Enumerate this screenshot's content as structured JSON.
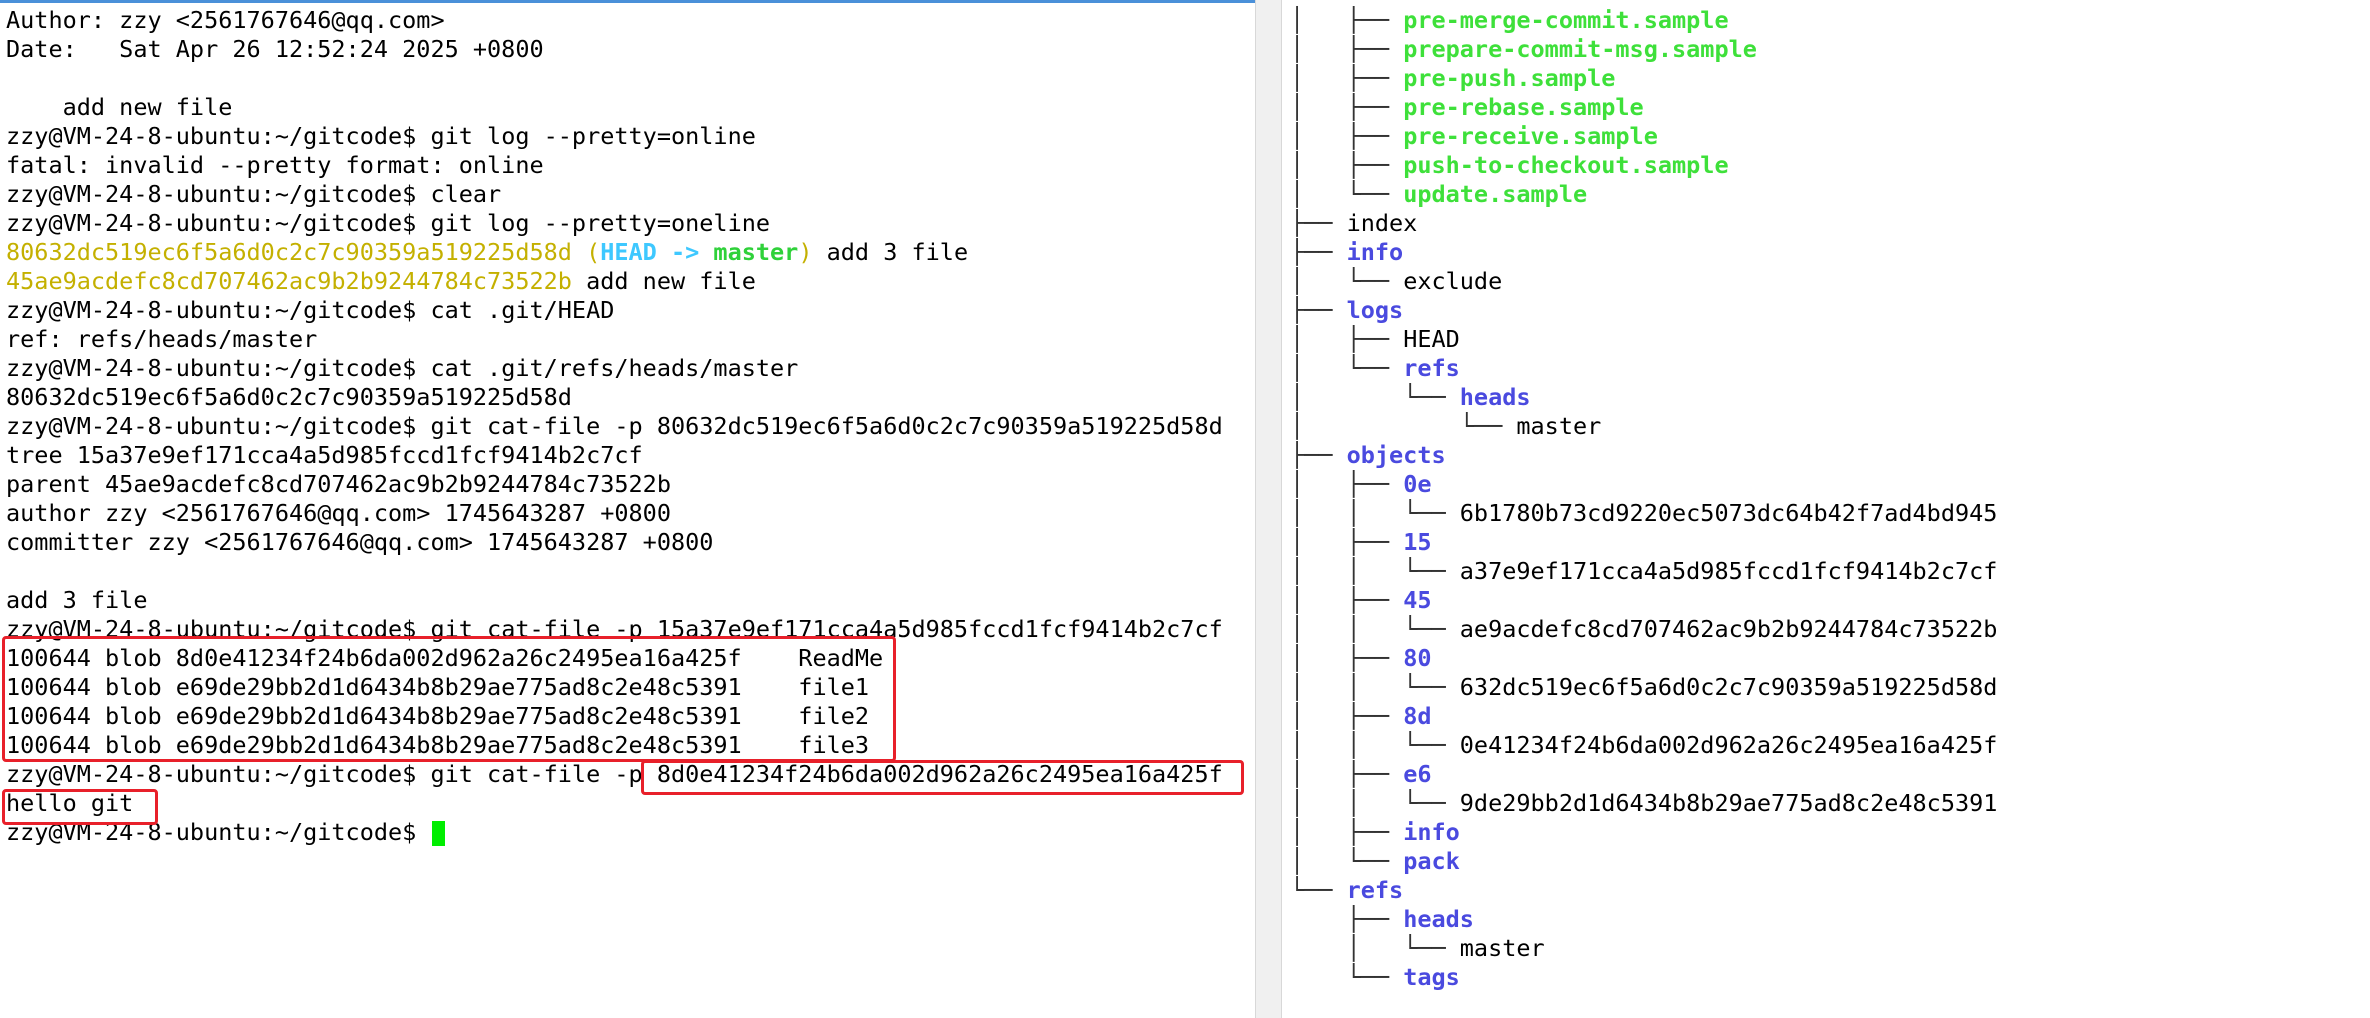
{
  "terminal": {
    "prompt": "zzy@VM-24-8-ubuntu:~/gitcode$ ",
    "lines": [
      {
        "text": "Author: zzy <2561767646@qq.com>"
      },
      {
        "text": "Date:   Sat Apr 26 12:52:24 2025 +0800"
      },
      {
        "text": ""
      },
      {
        "text": "    add new file"
      },
      {
        "prompt": true,
        "cmd": "git log --pretty=online"
      },
      {
        "text": "fatal: invalid --pretty format: online"
      },
      {
        "prompt": true,
        "cmd": "clear"
      },
      {
        "prompt": true,
        "cmd": "git log --pretty=oneline"
      },
      {
        "commit": {
          "hash": "80632dc519ec6f5a6d0c2c7c90359a519225d58d",
          "head": "HEAD",
          "arrow": "->",
          "branch": "master",
          "msg": " add 3 file"
        }
      },
      {
        "commit": {
          "hash": "45ae9acdefc8cd707462ac9b2b9244784c73522b",
          "msg": " add new file"
        }
      },
      {
        "prompt": true,
        "cmd": "cat .git/HEAD"
      },
      {
        "text": "ref: refs/heads/master"
      },
      {
        "prompt": true,
        "cmd": "cat .git/refs/heads/master"
      },
      {
        "text": "80632dc519ec6f5a6d0c2c7c90359a519225d58d"
      },
      {
        "prompt": true,
        "cmd": "git cat-file -p 80632dc519ec6f5a6d0c2c7c90359a519225d58d"
      },
      {
        "text": "tree 15a37e9ef171cca4a5d985fccd1fcf9414b2c7cf"
      },
      {
        "text": "parent 45ae9acdefc8cd707462ac9b2b9244784c73522b"
      },
      {
        "text": "author zzy <2561767646@qq.com> 1745643287 +0800"
      },
      {
        "text": "committer zzy <2561767646@qq.com> 1745643287 +0800"
      },
      {
        "text": ""
      },
      {
        "text": "add 3 file"
      },
      {
        "prompt": true,
        "cmd": "git cat-file -p 15a37e9ef171cca4a5d985fccd1fcf9414b2c7cf"
      },
      {
        "text": "100644 blob 8d0e41234f24b6da002d962a26c2495ea16a425f    ReadMe"
      },
      {
        "text": "100644 blob e69de29bb2d1d6434b8b29ae775ad8c2e48c5391    file1"
      },
      {
        "text": "100644 blob e69de29bb2d1d6434b8b29ae775ad8c2e48c5391    file2"
      },
      {
        "text": "100644 blob e69de29bb2d1d6434b8b29ae775ad8c2e48c5391    file3"
      },
      {
        "prompt": true,
        "cmd": "git cat-file -p 8d0e41234f24b6da002d962a26c2495ea16a425f"
      },
      {
        "text": "hello git"
      },
      {
        "prompt": true,
        "cmd": "",
        "cursor": true
      }
    ]
  },
  "tree": {
    "lines": [
      {
        "prefix": "│   ├── ",
        "name": "pre-merge-commit.sample",
        "kind": "exe"
      },
      {
        "prefix": "│   ├── ",
        "name": "prepare-commit-msg.sample",
        "kind": "exe"
      },
      {
        "prefix": "│   ├── ",
        "name": "pre-push.sample",
        "kind": "exe"
      },
      {
        "prefix": "│   ├── ",
        "name": "pre-rebase.sample",
        "kind": "exe"
      },
      {
        "prefix": "│   ├── ",
        "name": "pre-receive.sample",
        "kind": "exe"
      },
      {
        "prefix": "│   ├── ",
        "name": "push-to-checkout.sample",
        "kind": "exe"
      },
      {
        "prefix": "│   └── ",
        "name": "update.sample",
        "kind": "exe"
      },
      {
        "prefix": "├── ",
        "name": "index",
        "kind": "file"
      },
      {
        "prefix": "├── ",
        "name": "info",
        "kind": "dir"
      },
      {
        "prefix": "│   └── ",
        "name": "exclude",
        "kind": "file"
      },
      {
        "prefix": "├── ",
        "name": "logs",
        "kind": "dir"
      },
      {
        "prefix": "│   ├── ",
        "name": "HEAD",
        "kind": "file"
      },
      {
        "prefix": "│   └── ",
        "name": "refs",
        "kind": "dir"
      },
      {
        "prefix": "│       └── ",
        "name": "heads",
        "kind": "dir"
      },
      {
        "prefix": "│           └── ",
        "name": "master",
        "kind": "file"
      },
      {
        "prefix": "├── ",
        "name": "objects",
        "kind": "dir"
      },
      {
        "prefix": "│   ├── ",
        "name": "0e",
        "kind": "dir"
      },
      {
        "prefix": "│   │   └── ",
        "name": "6b1780b73cd9220ec5073dc64b42f7ad4bd945",
        "kind": "file"
      },
      {
        "prefix": "│   ├── ",
        "name": "15",
        "kind": "dir"
      },
      {
        "prefix": "│   │   └── ",
        "name": "a37e9ef171cca4a5d985fccd1fcf9414b2c7cf",
        "kind": "file"
      },
      {
        "prefix": "│   ├── ",
        "name": "45",
        "kind": "dir"
      },
      {
        "prefix": "│   │   └── ",
        "name": "ae9acdefc8cd707462ac9b2b9244784c73522b",
        "kind": "file"
      },
      {
        "prefix": "│   ├── ",
        "name": "80",
        "kind": "dir"
      },
      {
        "prefix": "│   │   └── ",
        "name": "632dc519ec6f5a6d0c2c7c90359a519225d58d",
        "kind": "file"
      },
      {
        "prefix": "│   ├── ",
        "name": "8d",
        "kind": "dir"
      },
      {
        "prefix": "│   │   └── ",
        "name": "0e41234f24b6da002d962a26c2495ea16a425f",
        "kind": "file"
      },
      {
        "prefix": "│   ├── ",
        "name": "e6",
        "kind": "dir"
      },
      {
        "prefix": "│   │   └── ",
        "name": "9de29bb2d1d6434b8b29ae775ad8c2e48c5391",
        "kind": "file"
      },
      {
        "prefix": "│   ├── ",
        "name": "info",
        "kind": "dir"
      },
      {
        "prefix": "│   └── ",
        "name": "pack",
        "kind": "dir"
      },
      {
        "prefix": "└── ",
        "name": "refs",
        "kind": "dir"
      },
      {
        "prefix": "    ├── ",
        "name": "heads",
        "kind": "dir"
      },
      {
        "prefix": "    │   └── ",
        "name": "master",
        "kind": "file"
      },
      {
        "prefix": "    └── ",
        "name": "tags",
        "kind": "dir"
      }
    ]
  }
}
